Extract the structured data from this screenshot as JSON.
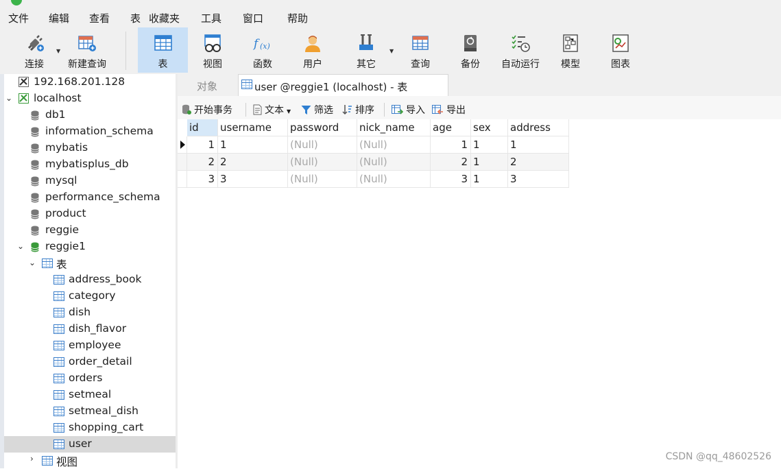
{
  "menu": [
    "文件",
    "编辑",
    "查看",
    "表",
    "收藏夹",
    "工具",
    "窗口",
    "帮助"
  ],
  "toolbar": {
    "connect": "连接",
    "new_query": "新建查询",
    "table": "表",
    "view": "视图",
    "function": "函数",
    "user": "用户",
    "other": "其它",
    "query": "查询",
    "backup": "备份",
    "automation": "自动运行",
    "model": "模型",
    "chart": "图表"
  },
  "tree": {
    "connection_remote": "192.168.201.128",
    "connection_local": "localhost",
    "databases": [
      "db1",
      "information_schema",
      "mybatis",
      "mybatisplus_db",
      "mysql",
      "performance_schema",
      "product",
      "reggie",
      "reggie1"
    ],
    "tables_folder": "表",
    "tables": [
      "address_book",
      "category",
      "dish",
      "dish_flavor",
      "employee",
      "order_detail",
      "orders",
      "setmeal",
      "setmeal_dish",
      "shopping_cart",
      "user"
    ],
    "views_folder": "视图"
  },
  "tabs": {
    "objects": "对象",
    "active": "user @reggie1 (localhost) - 表"
  },
  "grid_toolbar": {
    "begin_transaction": "开始事务",
    "text": "文本",
    "filter": "筛选",
    "sort": "排序",
    "import": "导入",
    "export": "导出"
  },
  "grid": {
    "columns": [
      "id",
      "username",
      "password",
      "nick_name",
      "age",
      "sex",
      "address"
    ],
    "rows": [
      [
        "1",
        "1",
        "(Null)",
        "(Null)",
        "1",
        "1",
        "1"
      ],
      [
        "2",
        "2",
        "(Null)",
        "(Null)",
        "2",
        "1",
        "2"
      ],
      [
        "3",
        "3",
        "(Null)",
        "(Null)",
        "3",
        "1",
        "3"
      ]
    ]
  },
  "watermark": "CSDN @qq_48602526",
  "colors": {
    "accent_selected": "#c9e0f7",
    "db_active_green": "#3a9a3a",
    "table_icon_blue": "#3a7dc9"
  }
}
